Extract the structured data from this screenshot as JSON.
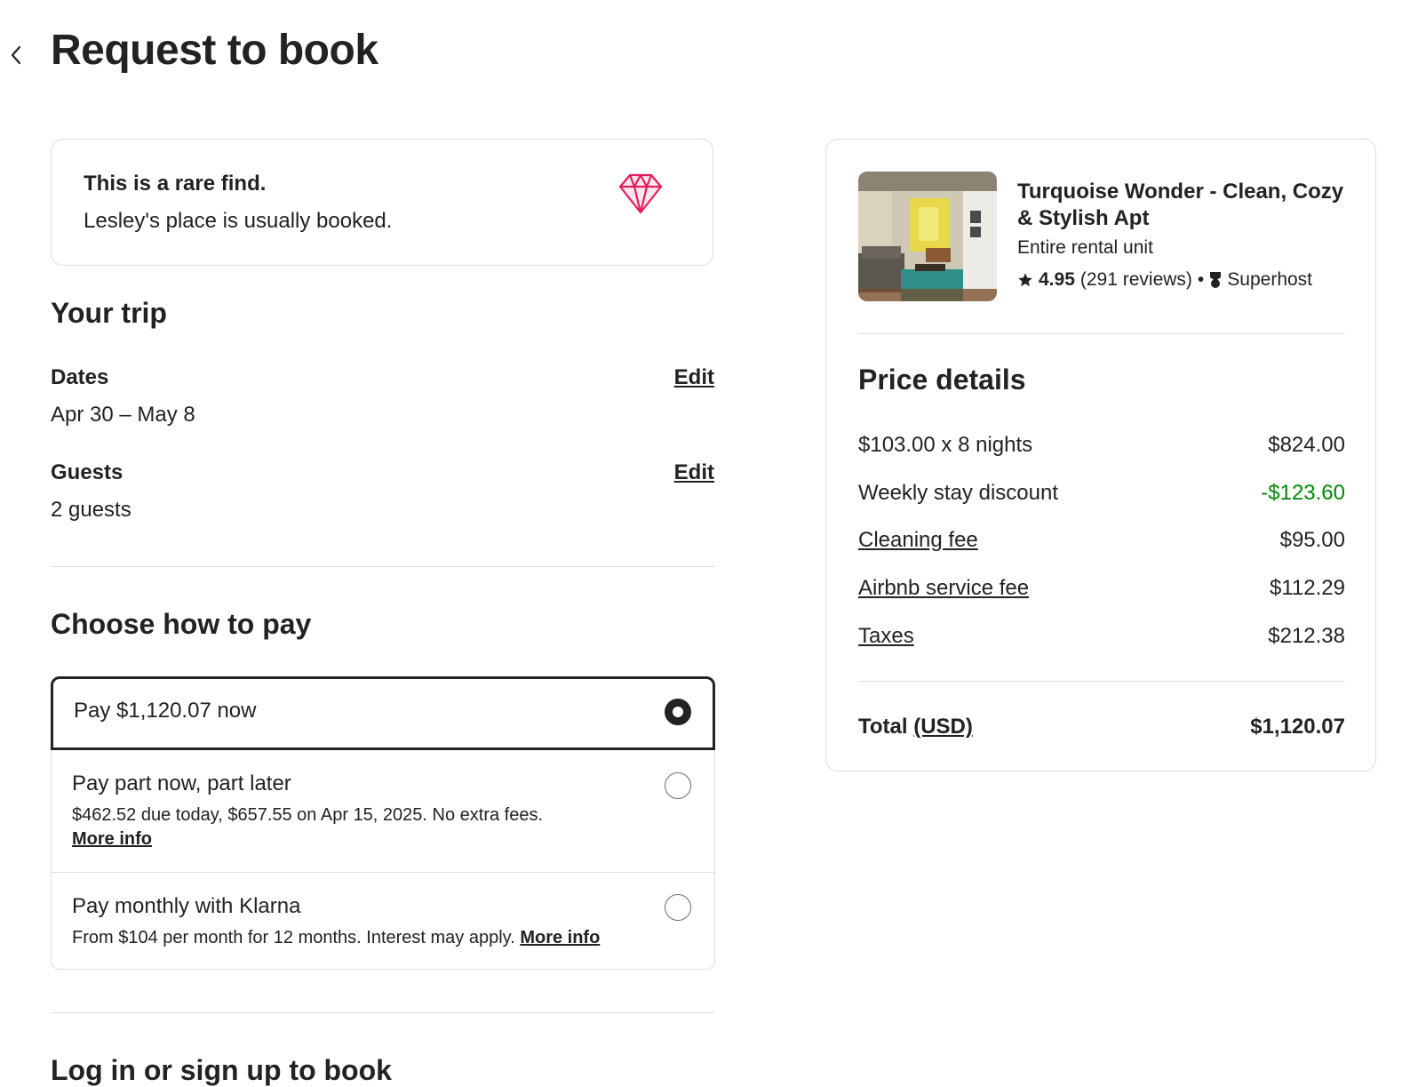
{
  "header": {
    "title": "Request to book",
    "back_icon": "chevron-left-icon"
  },
  "rare_find": {
    "title": "This is a rare find.",
    "subtitle": "Lesley's place is usually booked.",
    "icon": "diamond-icon",
    "icon_color": "#e31c5f"
  },
  "trip": {
    "title": "Your trip",
    "dates": {
      "label": "Dates",
      "value": "Apr 30 – May 8",
      "edit": "Edit"
    },
    "guests": {
      "label": "Guests",
      "value": "2 guests",
      "edit": "Edit"
    }
  },
  "payment": {
    "title": "Choose how to pay",
    "options": [
      {
        "title": "Pay $1,120.07 now",
        "selected": true
      },
      {
        "title": "Pay part now, part later",
        "description": "$462.52 due today, $657.55 on Apr 15, 2025. No extra fees.",
        "link": "More info",
        "selected": false
      },
      {
        "title": "Pay monthly with Klarna",
        "description": "From $104 per month for 12 months. Interest may apply.",
        "link": "More info",
        "selected": false
      }
    ]
  },
  "login": {
    "title": "Log in or sign up to book"
  },
  "listing": {
    "title": "Turquoise Wonder - Clean, Cozy & Stylish Apt",
    "type": "Entire rental unit",
    "rating": "4.95",
    "reviews": "(291 reviews)",
    "separator": "•",
    "superhost": "Superhost",
    "star_icon": "star-icon",
    "superhost_icon": "superhost-medal-icon"
  },
  "price_details": {
    "title": "Price details",
    "rows": [
      {
        "label": "$103.00 x 8 nights",
        "amount": "$824.00"
      },
      {
        "label": "Weekly stay discount",
        "amount": "-$123.60"
      },
      {
        "label": "Cleaning fee",
        "amount": "$95.00"
      },
      {
        "label": "Airbnb service fee",
        "amount": "$112.29"
      },
      {
        "label": "Taxes",
        "amount": "$212.38"
      }
    ],
    "total_label": "Total",
    "currency": "(USD)",
    "total": "$1,120.07"
  },
  "colors": {
    "discount": "#008a05",
    "text": "#222222",
    "border": "#dddddd"
  }
}
